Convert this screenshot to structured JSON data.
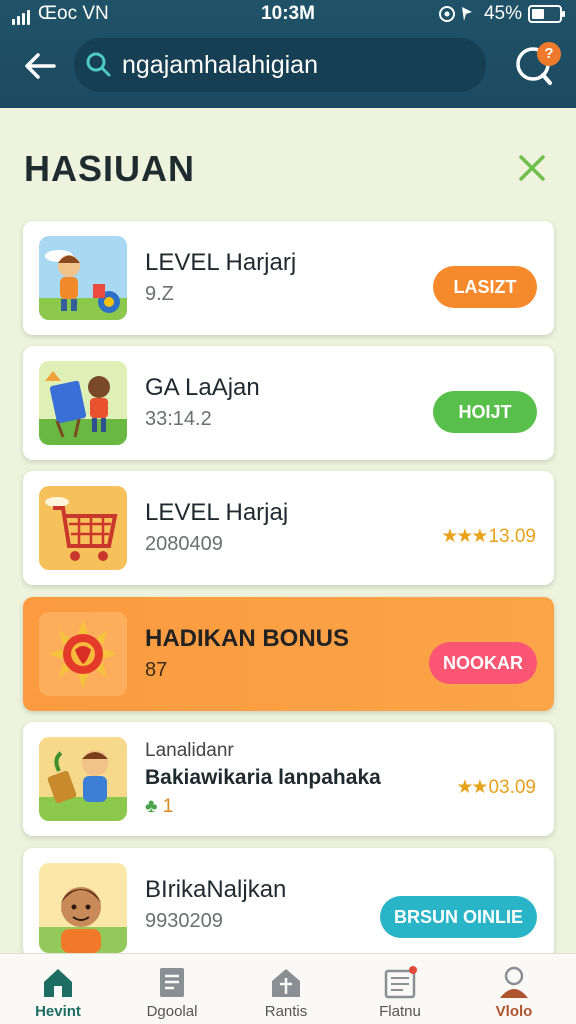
{
  "status": {
    "carrier": "Œoc VN",
    "time": "10:3M",
    "battery": "45%"
  },
  "header": {
    "search_value": "ngajamhalahigian",
    "badge": "?"
  },
  "sheet": {
    "title": "HASIUAN"
  },
  "cards": [
    {
      "title": "LEVEL Harjarj",
      "sub": "9.Z",
      "button": "LASIZT",
      "button_color": "#f7892d"
    },
    {
      "title": "GA LaAjan",
      "sub": "33:14.2",
      "button": "HOIJT",
      "button_color": "#58c04a"
    },
    {
      "title": "LEVEL Harjaj",
      "sub": "2080409",
      "stars": "★★★",
      "rating": "13.09"
    },
    {
      "title": "HADIKAN BONUS",
      "sub": "87",
      "button": "NOOKAR",
      "button_color": "#fb5574"
    },
    {
      "small": "Lanalidanr",
      "title": "Bakiawikaria lanpahaka",
      "sub": "1",
      "stars": "★★",
      "rating": "03.09"
    },
    {
      "title": "BIrikaNaljkan",
      "sub": "9930209",
      "button": "BRSUN OINLIE",
      "button_color": "#2ab4c8"
    }
  ],
  "tabs": [
    {
      "label": "Hevint"
    },
    {
      "label": "Dgoolal"
    },
    {
      "label": "Rantis"
    },
    {
      "label": "Flatnu"
    },
    {
      "label": "Vlolo"
    }
  ],
  "colors": {
    "header_bg": "#1f5268",
    "accent_green": "#6fbf4a",
    "bonus_orange": "#fb9a3f",
    "active_tab": "#1d6d63"
  }
}
